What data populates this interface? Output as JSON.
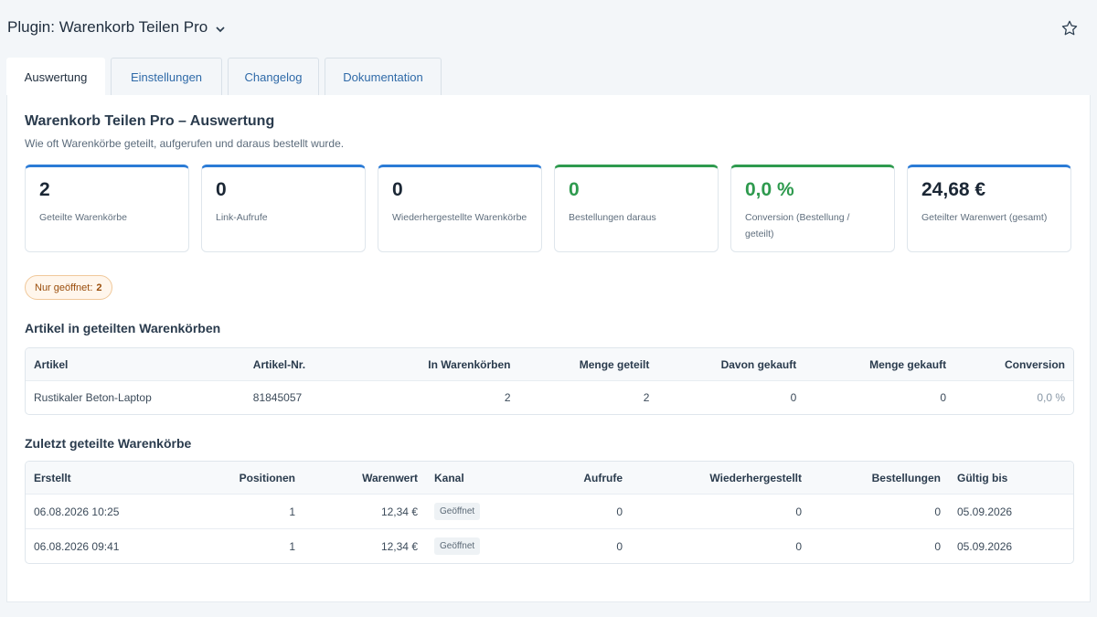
{
  "header": {
    "title": "Plugin: Warenkorb Teilen Pro"
  },
  "tabs": [
    {
      "label": "Auswertung"
    },
    {
      "label": "Einstellungen"
    },
    {
      "label": "Changelog"
    },
    {
      "label": "Dokumentation"
    }
  ],
  "section": {
    "title": "Warenkorb Teilen Pro – Auswertung",
    "subtitle": "Wie oft Warenkörbe geteilt, aufgerufen und daraus bestellt wurde."
  },
  "cards": [
    {
      "value": "2",
      "label": "Geteilte Warenkörbe"
    },
    {
      "value": "0",
      "label": "Link-Aufrufe"
    },
    {
      "value": "0",
      "label": "Wiederhergestellte Warenkörbe"
    },
    {
      "value": "0",
      "label": "Bestellungen daraus"
    },
    {
      "value": "0,0 %",
      "label": "Conversion (Bestellung / geteilt)"
    },
    {
      "value": "24,68 €",
      "label": "Geteilter Warenwert (gesamt)"
    }
  ],
  "filter": {
    "label": "Nur geöffnet:",
    "count": "2"
  },
  "articles": {
    "title": "Artikel in geteilten Warenkörben",
    "headers": [
      "Artikel",
      "Artikel-Nr.",
      "In Warenkörben",
      "Menge geteilt",
      "Davon gekauft",
      "Menge gekauft",
      "Conversion"
    ],
    "rows": [
      [
        "Rustikaler Beton-Laptop",
        "81845057",
        "2",
        "2",
        "0",
        "0",
        "0,0 %"
      ]
    ]
  },
  "recent": {
    "title": "Zuletzt geteilte Warenkörbe",
    "headers": [
      "Erstellt",
      "Positionen",
      "Warenwert",
      "Kanal",
      "Aufrufe",
      "Wiederhergestellt",
      "Bestellungen",
      "Gültig bis"
    ],
    "rows": [
      [
        "06.08.2026 10:25",
        "1",
        "12,34 €",
        "Geöffnet",
        "0",
        "0",
        "0",
        "05.09.2026"
      ],
      [
        "06.08.2026 09:41",
        "1",
        "12,34 €",
        "Geöffnet",
        "0",
        "0",
        "0",
        "05.09.2026"
      ]
    ]
  },
  "icons": {
    "title_chevron": "chevron-down-icon",
    "favorite": "star-icon"
  },
  "colors": {
    "accent_blue": "#2b7bd6",
    "accent_green": "#2e9a4e",
    "badge_orange": "#9a4d0b"
  }
}
